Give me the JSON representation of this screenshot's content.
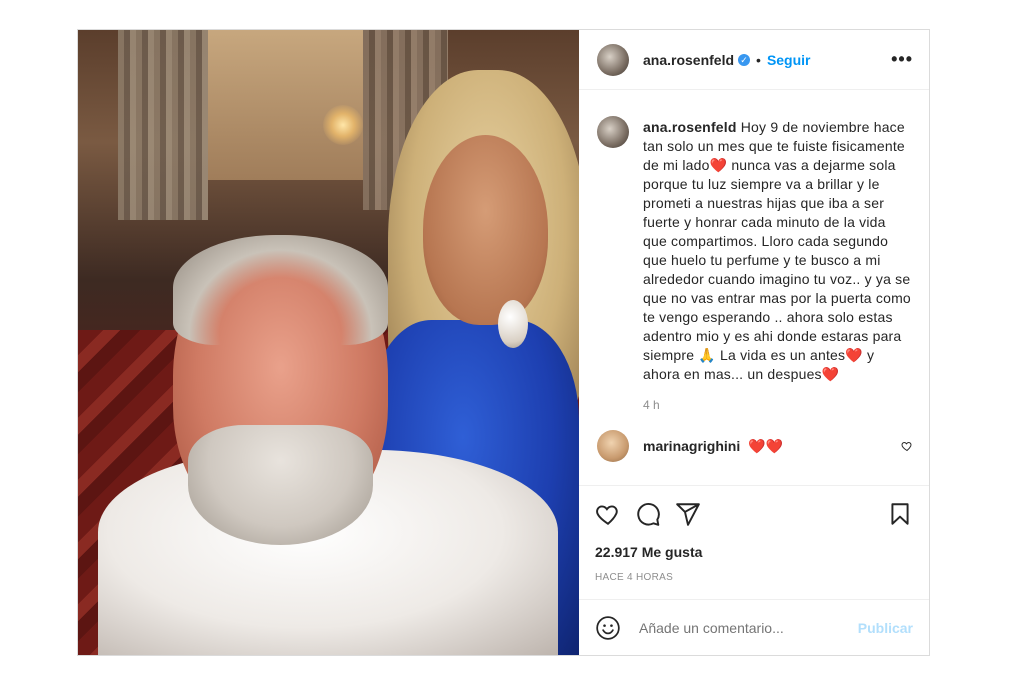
{
  "header": {
    "username": "ana.rosenfeld",
    "verified_icon": "verified-badge-icon",
    "separator": "•",
    "follow_label": "Seguir",
    "more_label": "•••"
  },
  "caption": {
    "username": "ana.rosenfeld",
    "text": "Hoy 9 de noviembre hace tan solo un mes que te fuiste fisicamente de mi lado❤️ nunca vas a dejarme sola porque tu luz siempre va a brillar y le prometi a nuestras hijas que iba a ser fuerte y honrar cada minuto de la vida que compartimos. Lloro cada segundo que huelo tu perfume y te busco a mi alrededor cuando imagino tu voz.. y ya se que no vas entrar mas por la puerta como te vengo esperando .. ahora solo estas adentro mio y es ahi donde estaras para siempre 🙏 La vida es un antes❤️ y ahora en mas... un despues❤️",
    "time": "4 h"
  },
  "comment": {
    "username": "marinagrighini",
    "text": "❤️❤️",
    "like_icon": "heart-outline-icon"
  },
  "actions": {
    "icons": [
      "heart-icon",
      "comment-icon",
      "share-icon",
      "bookmark-icon"
    ],
    "likes": "22.917 Me gusta",
    "posted": "HACE 4 HORAS"
  },
  "add_comment": {
    "placeholder": "Añade un comentario...",
    "post_label": "Publicar",
    "emoji_icon": "emoji-icon"
  },
  "colors": {
    "accent": "#0095f6",
    "post_disabled": "#b2dffc",
    "verified": "#3897f0",
    "heart": "#e0245e"
  }
}
